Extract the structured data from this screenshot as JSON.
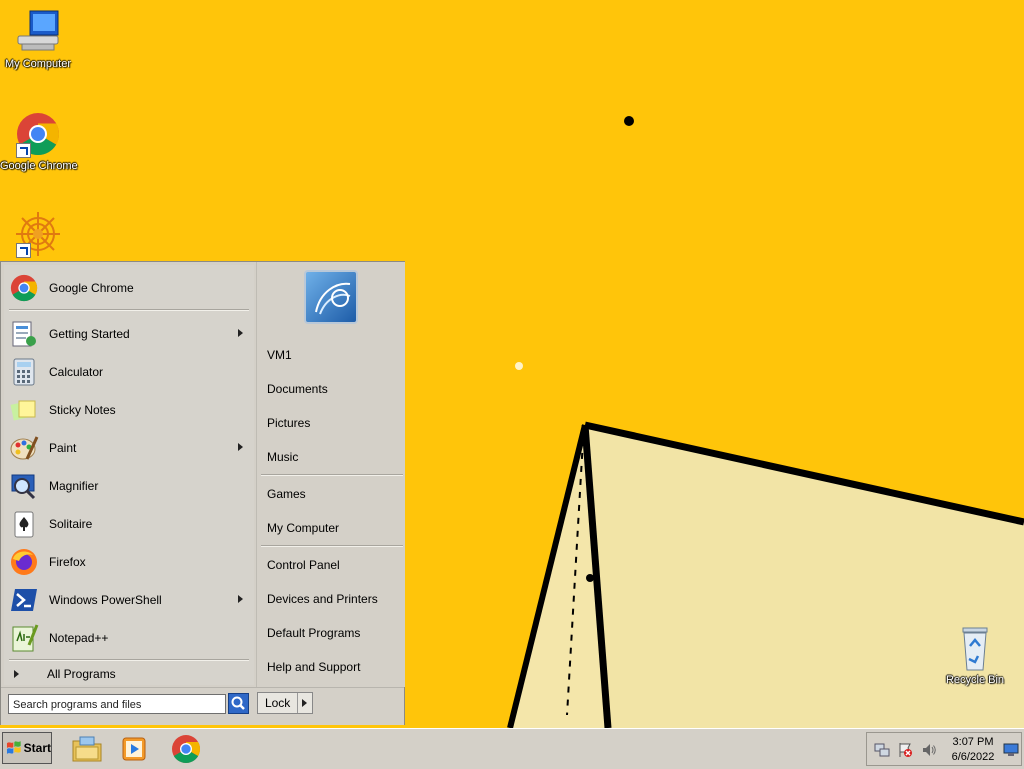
{
  "desktop_icons": [
    {
      "label": "My Computer"
    },
    {
      "label": "Google Chrome"
    },
    {
      "label": ""
    },
    {
      "label": "Recycle Bin"
    }
  ],
  "start_menu": {
    "pinned": [
      {
        "label": "Google Chrome",
        "icon": "chrome-icon"
      }
    ],
    "programs": [
      {
        "label": "Getting Started",
        "icon": "getting-started-icon",
        "submenu": true
      },
      {
        "label": "Calculator",
        "icon": "calculator-icon",
        "submenu": false
      },
      {
        "label": "Sticky Notes",
        "icon": "sticky-notes-icon",
        "submenu": false
      },
      {
        "label": "Paint",
        "icon": "paint-icon",
        "submenu": true
      },
      {
        "label": "Magnifier",
        "icon": "magnifier-icon",
        "submenu": false
      },
      {
        "label": "Solitaire",
        "icon": "solitaire-icon",
        "submenu": false
      },
      {
        "label": "Firefox",
        "icon": "firefox-icon",
        "submenu": false
      },
      {
        "label": "Windows PowerShell",
        "icon": "powershell-icon",
        "submenu": true
      },
      {
        "label": "Notepad++",
        "icon": "notepadpp-icon",
        "submenu": false
      }
    ],
    "all_programs": "All Programs",
    "right_links": [
      {
        "label": "VM1"
      },
      {
        "label": "Documents"
      },
      {
        "label": "Pictures"
      },
      {
        "label": "Music"
      },
      {
        "label": "Games"
      },
      {
        "label": "My Computer"
      },
      {
        "label": "Control Panel"
      },
      {
        "label": "Devices and Printers"
      },
      {
        "label": "Default Programs"
      },
      {
        "label": "Help and Support"
      }
    ],
    "search_placeholder": "Search programs and files",
    "lock_label": "Lock"
  },
  "taskbar": {
    "start_label": "Start",
    "pinned": [
      {
        "icon": "file-explorer-icon"
      },
      {
        "icon": "media-player-icon"
      },
      {
        "icon": "chrome-icon"
      }
    ],
    "clock": {
      "time": "3:07 PM",
      "date": "6/6/2022"
    }
  },
  "colors": {
    "wallpaper": "#ffc50a",
    "pyramid_face": "#f2e4a6",
    "menu_bg": "#d4d0c8"
  }
}
